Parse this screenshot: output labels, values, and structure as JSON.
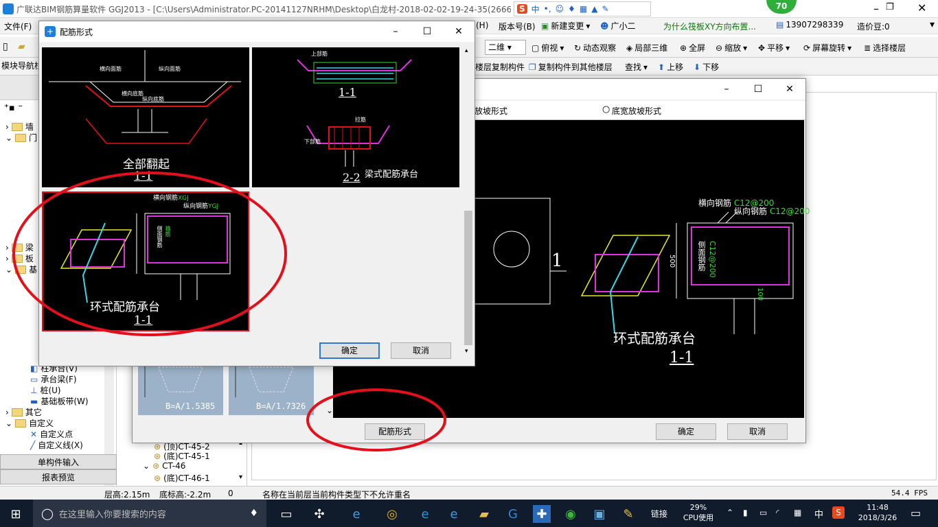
{
  "app": {
    "title": "广联达BIM钢筋算量软件 GGJ2013 - [C:\\Users\\Administrator.PC-20141127NRHM\\Desktop\\白龙村-2018-02-02-19-24-35(2666版",
    "badge": "70",
    "link_text": "为什么筏板XY方向布置...",
    "phone": "13907298339",
    "price_label": "造价豆:0"
  },
  "menu": {
    "file": "文件(F)",
    "help_partial": "(H)",
    "version": "版本号(B)",
    "new_change": "新建变更",
    "assistant": "广小二"
  },
  "toolbar": {
    "view_mode": "二维",
    "top_view": "俯视",
    "dynamic": "动态观察",
    "local_3d": "局部三维",
    "fullscreen": "全屏",
    "zoom": "缩放",
    "pan": "平移",
    "rotate": "屏幕旋转",
    "select_floor": "选择楼层",
    "floor_copy": "楼层复制构件",
    "copy_to_floor": "复制构件到其他楼层",
    "find": "查找",
    "move_up": "上移",
    "move_down": "下移"
  },
  "left_panel": {
    "nav_title": "模块导航栏",
    "items": [
      "墙",
      "门",
      "梁",
      "板",
      "基",
      "柱承台(V)",
      "承台梁(F)",
      "桩(U)",
      "基础板带(W)",
      "其它",
      "自定义",
      "自定义点",
      "自定义线(X)"
    ],
    "single_input": "单构件输入",
    "report_preview": "报表预览"
  },
  "mid_panel": {
    "formula1": "B=A/1.5385",
    "formula2": "B=A/1.7326",
    "tree": [
      "(顶)CT-45-2",
      "(底)CT-45-1",
      "CT-46",
      "(底)CT-46-1"
    ]
  },
  "back_dialog": {
    "radio1": "放坡形式",
    "radio2": "底宽放坡形式",
    "rebar_form_button": "配筋形式",
    "ok": "确定",
    "cancel": "取消",
    "drawing": {
      "horizontal_rebar": "横向钢筋",
      "horizontal_spec": "C12@200",
      "vertical_rebar": "纵向钢筋",
      "vertical_spec": "C12@200",
      "side_rebar": "侧面钢筋",
      "side_spec": "C12@200",
      "dim_500": "500",
      "dim_100": "100",
      "section_label": "1",
      "title": "环式配筋承台",
      "section": "1-1"
    }
  },
  "front_dialog": {
    "title": "配筋形式",
    "options": [
      {
        "label": "全部翻起",
        "section": "1-1"
      },
      {
        "label": "梁式配筋承台",
        "section": "2-2",
        "upper_section": "1-1"
      },
      {
        "label": "环式配筋承台",
        "section": "1-1"
      }
    ],
    "small_labels": {
      "hjr": "横向面筋",
      "zxmj": "纵向面筋",
      "hxdj": "横向底筋",
      "zxdj": "纵向底筋",
      "sbj": "上部筋",
      "ljj": "拉筋",
      "xbj": "下部筋",
      "gj": "箍筋",
      "hxgj": "横向钢筋",
      "zxgj": "纵向钢筋",
      "cmgj": "侧面钢筋"
    },
    "ok": "确定",
    "cancel": "取消"
  },
  "status": {
    "floor_height": "层高:2.15m",
    "base_elev": "底标高:-2.2m",
    "zero": "0",
    "message": "名称在当前层当前构件类型下不允许重名",
    "fps": "54.4 FPS"
  },
  "taskbar": {
    "search_placeholder": "在这里输入你要搜索的内容",
    "link": "链接",
    "cpu_pct": "29%",
    "cpu_label": "CPU使用",
    "ime": "中",
    "time": "11:48",
    "date": "2018/3/26"
  },
  "colors": {
    "annotation_red": "#e3101b",
    "magenta": "#e030e0",
    "cyan": "#38d8e8",
    "yellow": "#e8e820",
    "green_label": "#33dd33"
  }
}
